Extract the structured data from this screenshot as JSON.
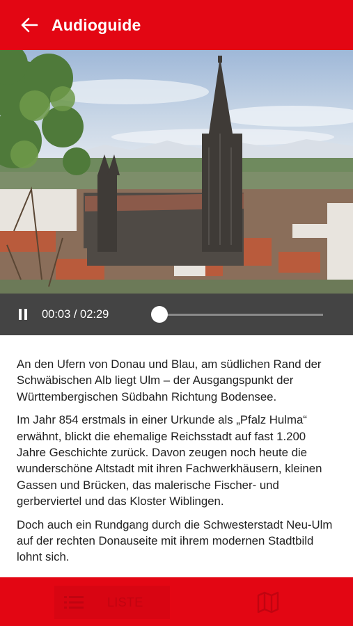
{
  "app_bar": {
    "title": "Audioguide",
    "back_icon": "arrow-left-icon"
  },
  "hero": {
    "subject": "Ulm Minster cityscape"
  },
  "player": {
    "state_icon": "pause-icon",
    "time": "00:03 / 02:29",
    "progress": 0.02
  },
  "article": {
    "paragraphs": [
      "An den Ufern von Donau und Blau, am südlichen Rand der Schwäbischen Alb liegt Ulm – der Ausgangspunkt der Württembergischen Südbahn Richtung Bodensee.",
      "Im Jahr 854 erstmals in einer Urkunde als „Pfalz Hulma“ erwähnt, blickt die ehemalige Reichsstadt auf fast 1.200 Jahre Geschichte zurück. Davon zeugen noch heute die wunderschöne Altstadt mit ihren Fachwerkhäusern, kleinen Gassen und Brücken, das malerische Fischer- und gerberviertel und das Kloster Wiblingen.",
      "Doch auch ein Rundgang durch die Schwesterstadt Neu-Ulm auf der rechten Donauseite mit ihrem modernen Stadtbild lohnt sich."
    ]
  },
  "bottom_nav": {
    "list_label": "LISTE",
    "list_icon": "list-icon",
    "map_icon": "map-icon"
  },
  "colors": {
    "brand_red": "#e30613",
    "player_bg": "#444444"
  }
}
